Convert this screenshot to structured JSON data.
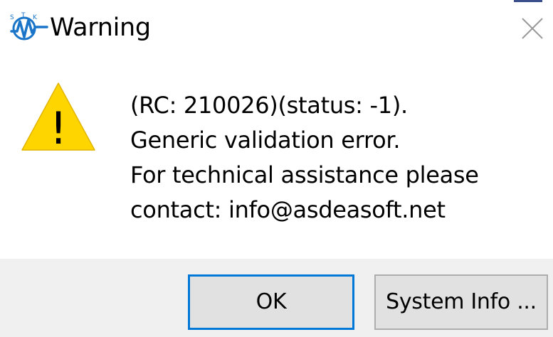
{
  "window": {
    "title": "Warning",
    "app_icon": "stk-logo-icon",
    "app_icon_letters": [
      "S",
      "T",
      "K"
    ],
    "close_icon": "close-icon"
  },
  "message": {
    "icon": "warning-triangle-icon",
    "icon_glyph": "!",
    "lines": [
      "(RC: 210026)(status: -1).",
      "Generic validation error.",
      "For technical assistance please",
      "contact: info@asdeasoft.net"
    ]
  },
  "buttons": {
    "ok_label": "OK",
    "system_info_label": "System Info ..."
  },
  "colors": {
    "warning_fill": "#ffd500",
    "focus_border": "#0078d7",
    "footer_bg": "#f0f0f0",
    "logo_blue": "#1a75c8"
  }
}
